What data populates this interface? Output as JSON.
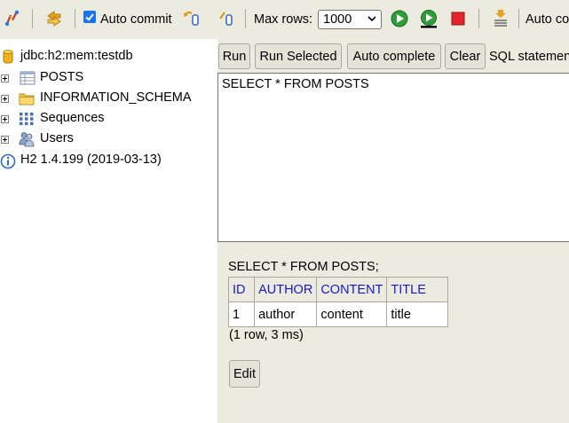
{
  "toolbar": {
    "icons": [
      "disconnect-icon",
      "refresh-icon",
      "auto-commit-checkbox",
      "rollback-icon",
      "commit-icon",
      "run-icon",
      "run-selected-icon",
      "stop-icon",
      "history-icon"
    ],
    "auto_commit_label": "Auto commit",
    "auto_commit_checked": true,
    "max_rows_label": "Max rows:",
    "max_rows_value": "1000",
    "auto_complete_label": "Auto co"
  },
  "tree": {
    "connection": "jdbc:h2:mem:testdb",
    "items": [
      {
        "label": "POSTS",
        "icon": "table-icon"
      },
      {
        "label": "INFORMATION_SCHEMA",
        "icon": "folder-icon"
      },
      {
        "label": "Sequences",
        "icon": "sequences-icon"
      },
      {
        "label": "Users",
        "icon": "users-icon"
      }
    ],
    "version": "H2 1.4.199 (2019-03-13)"
  },
  "query_buttons": {
    "run": "Run",
    "run_selected": "Run Selected",
    "auto_complete": "Auto complete",
    "clear": "Clear",
    "sql_label": "SQL statemen"
  },
  "editor": {
    "sql": "SELECT * FROM POSTS"
  },
  "result": {
    "sql": "SELECT * FROM POSTS;",
    "columns": [
      "ID",
      "AUTHOR",
      "CONTENT",
      "TITLE"
    ],
    "rows": [
      [
        "1",
        "author",
        "content",
        "title"
      ]
    ],
    "summary": "(1 row, 3 ms)",
    "edit_label": "Edit"
  },
  "colors": {
    "panel_bg": "#ecebe0",
    "header_link": "#1818d8",
    "checkbox": "#1a73e8"
  }
}
